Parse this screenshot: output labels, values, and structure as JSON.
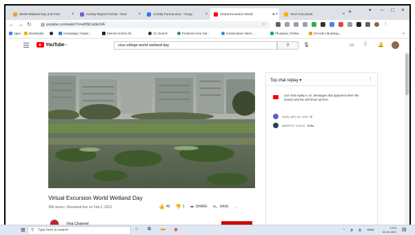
{
  "browser": {
    "tabs": [
      {
        "label": "World Wetland Day 2nd Febr",
        "color": "#e8a33d",
        "active": false
      },
      {
        "label": "Activity Report Format - hera",
        "color": "#7b5fc7",
        "active": false
      },
      {
        "label": "Activity Format.docx - Goog",
        "color": "#2b7de9",
        "active": false
      },
      {
        "label": "Virtual Excursion World",
        "color": "#ff0000",
        "active": true
      },
      {
        "label": "VIVA COLLEGE",
        "color": "#f6b100",
        "active": false
      }
    ],
    "new_tab": "+",
    "url": "youtube.com/watch?v=wDNCurbkXVA",
    "bookmarks": [
      {
        "label": "Apps",
        "color": "#4285f4"
      },
      {
        "label": "Bookmarks",
        "color": "#f4b400"
      },
      {
        "label": "",
        "color": "#222222"
      },
      {
        "label": "Homepage | Saylor...",
        "color": "#3c7bd9"
      },
      {
        "label": "Internet Archive Di...",
        "color": "#222222"
      },
      {
        "label": "CC Search",
        "color": "#333333"
      },
      {
        "label": "Protected Area Cat...",
        "color": "#4a8f4a"
      },
      {
        "label": "Conservation Intern...",
        "color": "#2a8ad9"
      },
      {
        "label": "Photopea | Online...",
        "color": "#18a497"
      },
      {
        "label": "Sci-Hub | Morphog...",
        "color": "#e0a020"
      }
    ]
  },
  "youtube": {
    "logo_text": "YouTube",
    "logo_sup": "IN",
    "search_value": "viva college world wetland day",
    "video": {
      "title": "Virtual Excursion World Wetland Day",
      "meta": "399 views • Streamed live on Feb 2, 2021",
      "likes": "49",
      "dislikes": "1",
      "share": "SHARE",
      "save": "SAVE",
      "more": "..."
    },
    "channel": {
      "name": "Viva Channel",
      "subscribe": "SUBSCRIBE"
    },
    "chat": {
      "title": "Top chat replay",
      "notice": "Live chat replay is on. Messages that appeared when the stream was live will show up here.",
      "messages": [
        {
          "author": "study with me neet",
          "text": "hi",
          "color": "#6a5acd"
        },
        {
          "author": "DEEPAK YADAV",
          "text": "hello",
          "color": "#2c3e50"
        }
      ]
    }
  },
  "taskbar": {
    "search_placeholder": "Type here to search",
    "tray_lang": "ENG",
    "time": "13:01",
    "date": "02-02-2021"
  }
}
